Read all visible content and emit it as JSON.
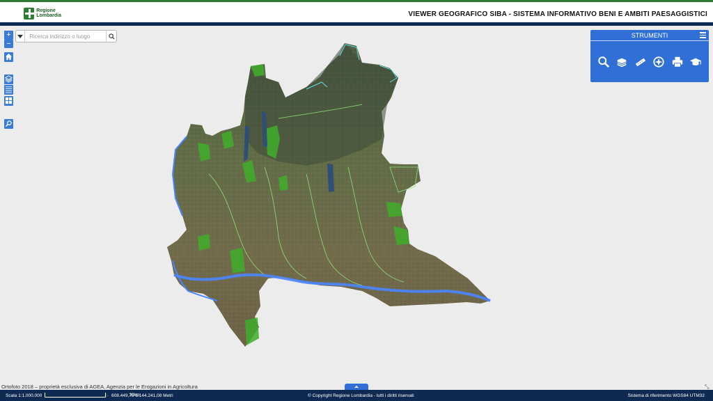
{
  "header": {
    "logo_line1": "Regione",
    "logo_line2": "Lombardia",
    "title": "VIEWER GEOGRAFICO SIBA - SISTEMA INFORMATIVO BENI E AMBITI PAESAGGISTICI"
  },
  "zoom": {
    "in_label": "+",
    "out_label": "−"
  },
  "search": {
    "placeholder": "Ricerca indirizzo o luogo",
    "value": ""
  },
  "tools": {
    "title": "STRUMENTI",
    "items": [
      "search-icon",
      "layers-stack-icon",
      "measure-icon",
      "compass-icon",
      "print-icon",
      "graduation-cap-icon"
    ]
  },
  "map": {
    "attribution": "Ortofoto 2018 – proprietà esclusiva di AGEA, Agenzia per le Erogazioni in Agricoltura"
  },
  "footer": {
    "scale": "Scala 1:1.000.000",
    "scalebar_label": "30km",
    "coords": "608.449,79 5.144.241,08 Metri",
    "copyright": "© Copyright Regione Lombardia - tutti i diritti riservati",
    "crs": "Sistema di riferimento WGS84 UTM32"
  },
  "colors": {
    "header_dark": "#0f2a52",
    "accent": "#2f6fd6",
    "brand_green": "#2e7d32"
  }
}
